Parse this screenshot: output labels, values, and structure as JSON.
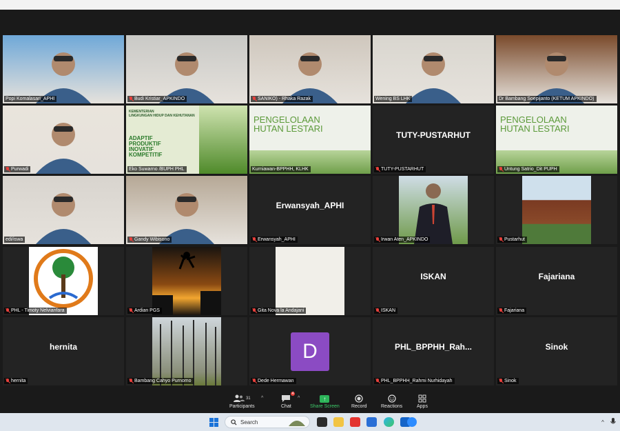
{
  "participants": [
    {
      "label": "Popi Komalasari_APHI",
      "muted": false,
      "bg": "#6fa8d8",
      "kind": "video"
    },
    {
      "label": "Budi Kristiar_APKINDO",
      "muted": true,
      "bg": "#c9c9c6",
      "kind": "video"
    },
    {
      "label": "SANIKO) - Rhaka Razak",
      "muted": true,
      "bg": "#cfc7bd",
      "kind": "video"
    },
    {
      "label": "Wening BS LHK",
      "muted": false,
      "bg": "#d9d6cf",
      "kind": "video",
      "active": true
    },
    {
      "label": "Dr Bambang Soepijanto (KETUM APKINDO)",
      "muted": false,
      "bg": "#7a4a2b",
      "kind": "video"
    },
    {
      "label": "Purwadi",
      "muted": true,
      "bg": "#e9e4dc",
      "kind": "video"
    },
    {
      "label": "Eko Suwarno /BUPH PHL",
      "muted": false,
      "bg": "#e4ebd3",
      "kind": "slide",
      "slide_lines": [
        "KEMENTERIAN",
        "LINGKUNGAN HIDUP DAN KEHUTANAN",
        "ADAPTIF",
        "PRODUKTIF",
        "INOVATIF",
        "KOMPETITIF"
      ]
    },
    {
      "label": "Kurniawan-BPPHH, KLHK",
      "muted": false,
      "bg": "#eef1ea",
      "kind": "slide2",
      "slide_lines": [
        "PENGELOLAAN",
        "HUTAN LESTARI"
      ]
    },
    {
      "label": "TUTY-PUSTARHUT",
      "muted": true,
      "bg": "#232323",
      "kind": "name",
      "name": "TUTY-PUSTARHUT"
    },
    {
      "label": "Untung Satrio_Dit PUPH",
      "muted": true,
      "bg": "#eef1ea",
      "kind": "slide2",
      "slide_lines": [
        "PENGELOLAAN",
        "HUTAN LESTARI"
      ]
    },
    {
      "label": "edi/iswa",
      "muted": false,
      "bg": "#d8d4ce",
      "kind": "video"
    },
    {
      "label": "Gandy Wibisono",
      "muted": true,
      "bg": "#b6a896",
      "kind": "video"
    },
    {
      "label": "Erwansyah_APHI",
      "muted": true,
      "bg": "#232323",
      "kind": "name",
      "name": "Erwansyah_APHI"
    },
    {
      "label": "Irwan Aten_APKINDO",
      "muted": true,
      "bg": "#232323",
      "kind": "photo"
    },
    {
      "label": "Pustarhut",
      "muted": true,
      "bg": "#232323",
      "kind": "building"
    },
    {
      "label": "PHL - Timoty Nelvianfara",
      "muted": true,
      "bg": "#232323",
      "kind": "logo"
    },
    {
      "label": "Ardian PGS",
      "muted": true,
      "bg": "#232323",
      "kind": "sunset"
    },
    {
      "label": "Gita Nova la Andajani",
      "muted": true,
      "bg": "#232323",
      "kind": "blank"
    },
    {
      "label": "ISKAN",
      "muted": true,
      "bg": "#232323",
      "kind": "name",
      "name": "ISKAN"
    },
    {
      "label": "Fajariana",
      "muted": true,
      "bg": "#232323",
      "kind": "name",
      "name": "Fajariana"
    },
    {
      "label": "hernita",
      "muted": true,
      "bg": "#232323",
      "kind": "name",
      "name": "hernita"
    },
    {
      "label": "Bambang Cahyo Purnomo",
      "muted": true,
      "bg": "#232323",
      "kind": "trees"
    },
    {
      "label": "Dede Hermawan",
      "muted": true,
      "bg": "#232323",
      "kind": "avatar",
      "initial": "D"
    },
    {
      "label": "PHL_BPPHH_Rahmi Nurhidayah",
      "muted": true,
      "bg": "#232323",
      "kind": "name",
      "name": "PHL_BPPHH_Rah..."
    },
    {
      "label": "Sinok",
      "muted": true,
      "bg": "#232323",
      "kind": "name",
      "name": "Sinok"
    }
  ],
  "controls": {
    "participants_label": "Participants",
    "participants_count": "31",
    "chat_label": "Chat",
    "chat_badge": "4",
    "share_label": "Share Screen",
    "record_label": "Record",
    "reactions_label": "Reactions",
    "apps_label": "Apps"
  },
  "taskbar": {
    "search_placeholder": "Search"
  },
  "colors": {
    "active_border": "#c9d64a",
    "muted_icon": "#e8413c",
    "share_green": "#2db55a"
  }
}
